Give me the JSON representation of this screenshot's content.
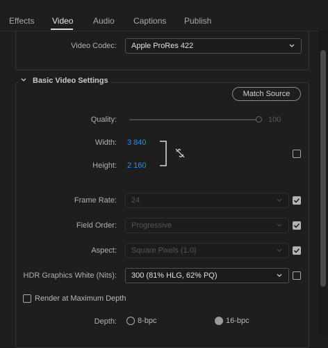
{
  "tabs": [
    {
      "label": "Effects",
      "active": false
    },
    {
      "label": "Video",
      "active": true
    },
    {
      "label": "Audio",
      "active": false
    },
    {
      "label": "Captions",
      "active": false
    },
    {
      "label": "Publish",
      "active": false
    }
  ],
  "video_codec": {
    "label": "Video Codec:",
    "value": "Apple ProRes 422"
  },
  "basic_settings": {
    "title": "Basic Video Settings",
    "match_source_label": "Match Source",
    "quality": {
      "label": "Quality:",
      "value": "100",
      "level": 1.0
    },
    "width": {
      "label": "Width:",
      "value": "3 840"
    },
    "height": {
      "label": "Height:",
      "value": "2 160"
    },
    "frame_rate": {
      "label": "Frame Rate:",
      "value": "24",
      "checked": true
    },
    "field_order": {
      "label": "Field Order:",
      "value": "Progressive",
      "checked": true
    },
    "aspect": {
      "label": "Aspect:",
      "value": "Square Pixels (1.0)",
      "checked": true
    },
    "hdr_white": {
      "label": "HDR Graphics White (Nits):",
      "value": "300 (81% HLG, 62% PQ)",
      "checked": false
    },
    "render_max_depth": {
      "label": "Render at Maximum Depth",
      "checked": false
    },
    "depth": {
      "label": "Depth:",
      "option_8": "8-bpc",
      "option_16": "16-bpc",
      "selected": "16-bpc"
    }
  },
  "icons": {
    "collapse": "chevron-down-icon",
    "link": "unlink-chain-icon",
    "dropdown": "chevron-down-icon"
  },
  "colors": {
    "accent_blue": "#2d8ceb",
    "background": "#1e1e1e"
  }
}
